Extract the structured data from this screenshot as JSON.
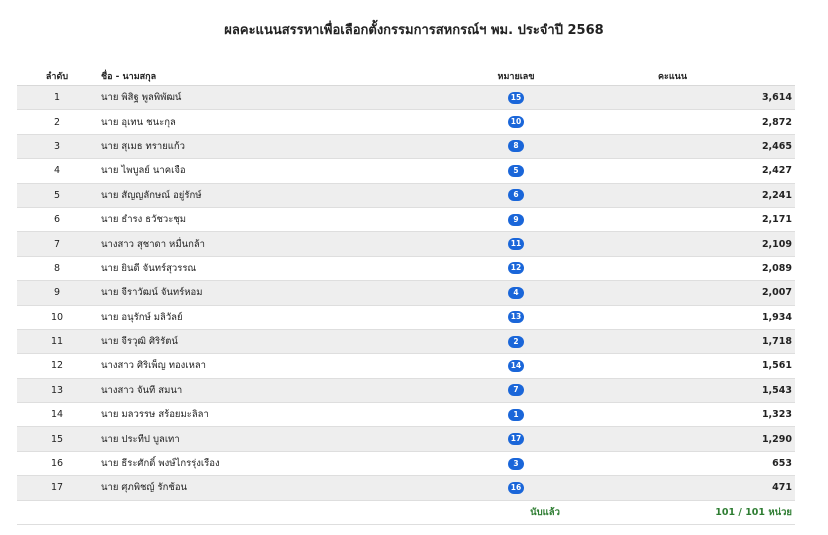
{
  "title": "ผลคะแนนสรรหาเพื่อเลือกตั้งกรรมการสหกรณ์ฯ พม. ประจำปี 2568",
  "headers": {
    "rank": "ลำดับ",
    "name": "ชื่อ - นามสกุล",
    "number": "หมายเลข",
    "score": "คะแนน"
  },
  "rows": [
    {
      "rank": "1",
      "name": "นาย พิสิฐ พูลพิพัฒน์",
      "number": "15",
      "score": "3,614"
    },
    {
      "rank": "2",
      "name": "นาย อุเทน ชนะกุล",
      "number": "10",
      "score": "2,872"
    },
    {
      "rank": "3",
      "name": "นาย สุเมธ ทรายแก้ว",
      "number": "8",
      "score": "2,465"
    },
    {
      "rank": "4",
      "name": "นาย ไพบูลย์ นาคเจือ",
      "number": "5",
      "score": "2,427"
    },
    {
      "rank": "5",
      "name": "นาย สัญญลักษณ์ อยู่รักษ์",
      "number": "6",
      "score": "2,241"
    },
    {
      "rank": "6",
      "name": "นาย ธำรง ธวัชวะชุม",
      "number": "9",
      "score": "2,171"
    },
    {
      "rank": "7",
      "name": "นางสาว สุชาดา หมื่นกล้า",
      "number": "11",
      "score": "2,109"
    },
    {
      "rank": "8",
      "name": "นาย ยินดี จันทร์สุวรรณ",
      "number": "12",
      "score": "2,089"
    },
    {
      "rank": "9",
      "name": "นาย จีราวัฒน์ จันทร์หอม",
      "number": "4",
      "score": "2,007"
    },
    {
      "rank": "10",
      "name": "นาย อนุรักษ์ มลิวัลย์",
      "number": "13",
      "score": "1,934"
    },
    {
      "rank": "11",
      "name": "นาย จีรวุฒิ ศิริรัตน์",
      "number": "2",
      "score": "1,718"
    },
    {
      "rank": "12",
      "name": "นางสาว ศิริเพ็ญ ทองเหลา",
      "number": "14",
      "score": "1,561"
    },
    {
      "rank": "13",
      "name": "นางสาว จันที สมนา",
      "number": "7",
      "score": "1,543"
    },
    {
      "rank": "14",
      "name": "นาย มลวรรษ สร้อยมะลิลา",
      "number": "1",
      "score": "1,323"
    },
    {
      "rank": "15",
      "name": "นาย ประทีป บูลเทา",
      "number": "17",
      "score": "1,290"
    },
    {
      "rank": "16",
      "name": "นาย ธีระศักดิ์ พงษ์ไกรรุ่งเรือง",
      "number": "3",
      "score": "653"
    },
    {
      "rank": "17",
      "name": "นาย ศุภพิชญ์ รักช้อน",
      "number": "16",
      "score": "471"
    }
  ],
  "footer": {
    "counted_label": "นับแล้ว",
    "total": "101 / 101 หน่วย"
  },
  "colors": {
    "badge": "#1a66d9",
    "footer_text": "#2e7d32",
    "stripe": "#eeeeee"
  }
}
